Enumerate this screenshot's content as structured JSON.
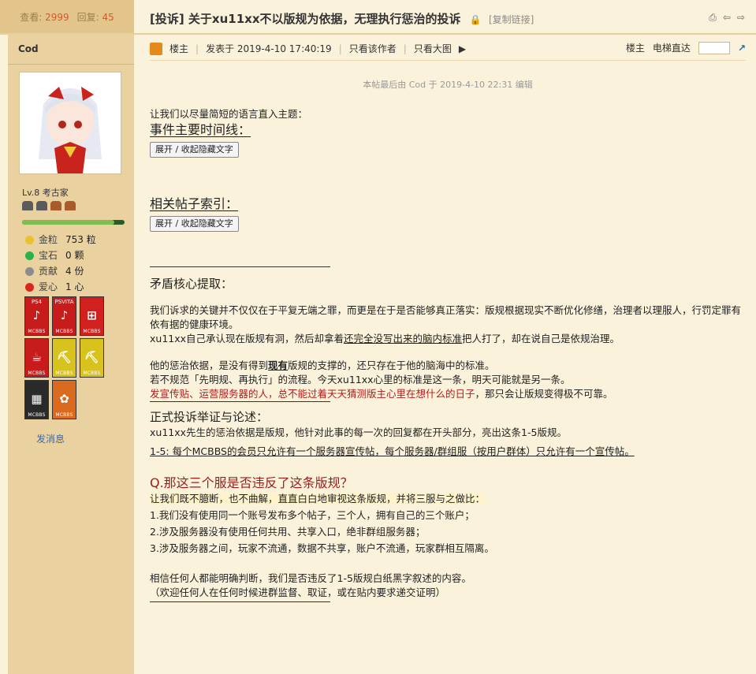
{
  "stats": {
    "views_label": "查看:",
    "views": "2999",
    "replies_label": "回复:",
    "replies": "45"
  },
  "thread": {
    "title": "[投诉] 关于xu11xx不以版规为依据，无理执行惩治的投诉",
    "copy_link": "[复制链接]"
  },
  "author": {
    "name": "Cod",
    "level": "Lv.8 考古家",
    "level_progress": 0.9,
    "props": [
      {
        "key": "金粒",
        "value": "753 粒",
        "color": "#e9c12c"
      },
      {
        "key": "宝石",
        "value": "0 颗",
        "color": "#2bb04a"
      },
      {
        "key": "贡献",
        "value": "4 份",
        "color": "#8c8c8c"
      },
      {
        "key": "爱心",
        "value": "1 心",
        "color": "#d9261c"
      }
    ],
    "badges": [
      {
        "top": "PS4",
        "glyph": "♪",
        "bg": "#c81c1c",
        "mark": "MCBBS"
      },
      {
        "top": "PSVITA",
        "glyph": "♪",
        "bg": "#c81c1c",
        "mark": "MCBBS"
      },
      {
        "top": "",
        "glyph": "⊞",
        "bg": "#d12020",
        "mark": "MCBBS"
      },
      {
        "top": "",
        "glyph": "☕",
        "bg": "#c81c1c",
        "mark": "MCBBS"
      },
      {
        "top": "",
        "glyph": "⛏",
        "bg": "#d8c21d",
        "mark": "MCBBS"
      },
      {
        "top": "",
        "glyph": "⛏",
        "bg": "#d8c21d",
        "mark": "MCBBS"
      },
      {
        "top": "",
        "glyph": "▦",
        "bg": "#2a2a2a",
        "mark": "MCBBS"
      },
      {
        "top": "",
        "glyph": "✿",
        "bg": "#d96a1f",
        "mark": "MCBBS"
      }
    ],
    "send_msg": "发消息"
  },
  "postbar": {
    "floor": "楼主",
    "posted": "发表于 2019-4-10 17:40:19",
    "only_author": "只看该作者",
    "big_image": "只看大图",
    "floor_right": "楼主",
    "elevator": "电梯直达"
  },
  "edited": "本帖最后由 Cod 于 2019-4-10 22:31 编辑",
  "content": {
    "intro": "让我们以尽量简短的语言直入主题：",
    "timeline_heading": "事件主要时间线：",
    "toggle1": "展开 / 收起隐藏文字",
    "index_heading": "相关帖子索引：",
    "toggle2": "展开 / 收起隐藏文字",
    "core_heading": "矛盾核心提取：",
    "para1": "我们诉求的关键并不仅仅在于平复无端之罪，而更是在于是否能够真正落实：版规根据现实不断优化修缮，治理者以理服人，行罚定罪有依有据的健康环境。",
    "para2_a": "xu11xx自己承认现在版规有洞，然后却拿着",
    "para2_b": "还完全没写出来的脑内标准",
    "para2_c": "把人打了，却在说自己是依规治理。",
    "para3_a": "他的惩治依据，是没有得到",
    "para3_b": "现有",
    "para3_c": "版规的支撑的，还只存在于他的脑海中的标准。",
    "para4": "若不规范「先明规、再执行」的流程。今天xu11xx心里的标准是这一条，明天可能就是另一条。",
    "para5_a": "发宣传贴、运营服务器的人，总不能过着天天猜测版主心里在想什么的日子",
    "para5_b": "，那只会让版规变得极不可靠。",
    "formal_heading": "正式投诉举证与论述：",
    "formal1": "xu11xx先生的惩治依据是版规，他针对此事的每一次的回复都在开头部分，亮出这条1-5版规。",
    "rule15": "1-5: 每个MCBBS的会员只允许有一个服务器宣传帖，每个服务器/群组服（按用户群体）只允许有一个宣传帖。",
    "q_heading": "Q.那这三个服是否违反了这条版规？",
    "compare": "让我们既不臆断，也不曲解，直直白白地审视这条版规，并将三服与之做比：",
    "item1": "1.我们没有使用同一个账号发布多个帖子，三个人，拥有自己的三个账户；",
    "item2": "2.涉及服务器没有使用任何共用、共享入口，绝非群组服务器；",
    "item3": "3.涉及服务器之间，玩家不流通，数据不共享，账户不流通，玩家群相互隔离。",
    "conclusion": "相信任何人都能明确判断，我们是否违反了1-5版规白纸黑字叙述的内容。",
    "welcome": "（欢迎任何人在任何时候进群监督、取证，或在贴内要求递交证明）"
  }
}
